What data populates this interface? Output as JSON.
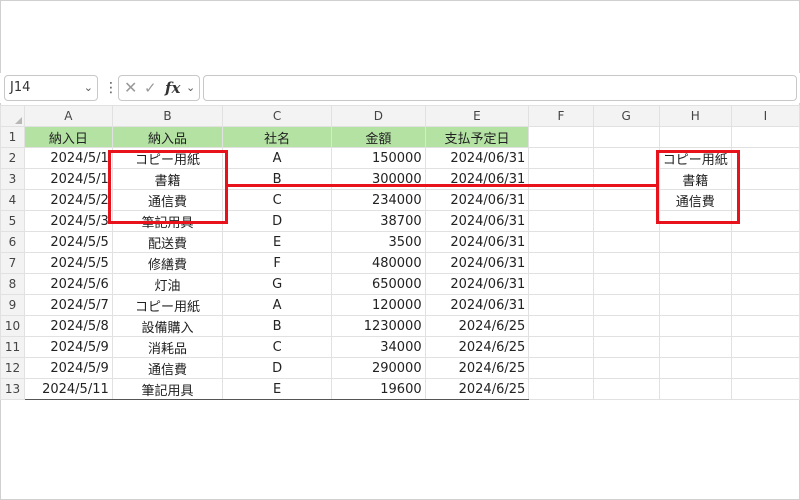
{
  "formula_bar": {
    "name_box": "J14",
    "formula": ""
  },
  "columns": [
    "A",
    "B",
    "C",
    "D",
    "E",
    "F",
    "G",
    "H",
    "I"
  ],
  "rows": [
    "1",
    "2",
    "3",
    "4",
    "5",
    "6",
    "7",
    "8",
    "9",
    "10",
    "11",
    "12",
    "13"
  ],
  "table": {
    "headers": [
      "納入日",
      "納入品",
      "社名",
      "金額",
      "支払予定日"
    ],
    "data": [
      [
        "2024/5/1",
        "コピー用紙",
        "A",
        "150000",
        "2024/06/31"
      ],
      [
        "2024/5/1",
        "書籍",
        "B",
        "300000",
        "2024/06/31"
      ],
      [
        "2024/5/2",
        "通信費",
        "C",
        "234000",
        "2024/06/31"
      ],
      [
        "2024/5/3",
        "筆記用具",
        "D",
        "38700",
        "2024/06/31"
      ],
      [
        "2024/5/5",
        "配送費",
        "E",
        "3500",
        "2024/06/31"
      ],
      [
        "2024/5/5",
        "修繕費",
        "F",
        "480000",
        "2024/06/31"
      ],
      [
        "2024/5/6",
        "灯油",
        "G",
        "650000",
        "2024/06/31"
      ],
      [
        "2024/5/7",
        "コピー用紙",
        "A",
        "120000",
        "2024/06/31"
      ],
      [
        "2024/5/8",
        "設備購入",
        "B",
        "1230000",
        "2024/6/25"
      ],
      [
        "2024/5/9",
        "消耗品",
        "C",
        "34000",
        "2024/6/25"
      ],
      [
        "2024/5/9",
        "通信費",
        "D",
        "290000",
        "2024/6/25"
      ],
      [
        "2024/5/11",
        "筆記用具",
        "E",
        "19600",
        "2024/6/25"
      ]
    ]
  },
  "pasted": [
    "コピー用紙",
    "書籍",
    "通信費"
  ],
  "colors": {
    "header_fill": "#b3e2a3",
    "highlight_red": "#e8121c",
    "marquee": "#1e6b3a"
  },
  "icons": {
    "cancel": "x-icon",
    "enter": "check-icon",
    "function": "fx-icon"
  }
}
